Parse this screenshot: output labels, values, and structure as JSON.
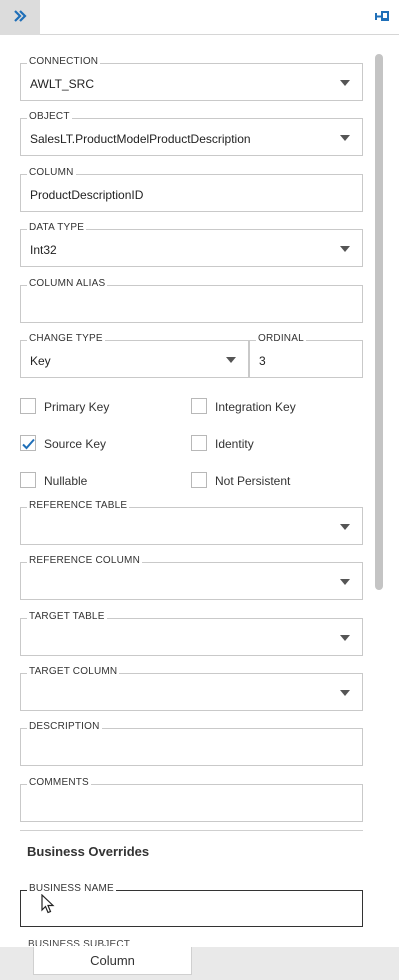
{
  "toolbar": {
    "collapse_icon": "double-chevron-right-icon",
    "pin_icon": "pin-icon",
    "accent_color": "#1f6fb8"
  },
  "fields": {
    "connection": {
      "label": "CONNECTION",
      "value": "AWLT_SRC"
    },
    "object": {
      "label": "OBJECT",
      "value": "SalesLT.ProductModelProductDescription"
    },
    "column": {
      "label": "COLUMN",
      "value": "ProductDescriptionID"
    },
    "data_type": {
      "label": "DATA TYPE",
      "value": "Int32"
    },
    "column_alias": {
      "label": "COLUMN ALIAS",
      "value": ""
    },
    "change_type": {
      "label": "CHANGE TYPE",
      "value": "Key"
    },
    "ordinal": {
      "label": "ORDINAL",
      "value": "3"
    },
    "reference_table": {
      "label": "REFERENCE TABLE",
      "value": ""
    },
    "reference_column": {
      "label": "REFERENCE COLUMN",
      "value": ""
    },
    "target_table": {
      "label": "TARGET TABLE",
      "value": ""
    },
    "target_column": {
      "label": "TARGET COLUMN",
      "value": ""
    },
    "description": {
      "label": "DESCRIPTION",
      "value": ""
    },
    "comments": {
      "label": "COMMENTS",
      "value": ""
    },
    "business_name": {
      "label": "BUSINESS NAME",
      "value": ""
    }
  },
  "checkboxes": {
    "primary_key": {
      "label": "Primary Key",
      "checked": false
    },
    "integration_key": {
      "label": "Integration Key",
      "checked": false
    },
    "source_key": {
      "label": "Source Key",
      "checked": true
    },
    "identity": {
      "label": "Identity",
      "checked": false
    },
    "nullable": {
      "label": "Nullable",
      "checked": false
    },
    "not_persistent": {
      "label": "Not Persistent",
      "checked": false
    }
  },
  "section": {
    "business_overrides": "Business Overrides",
    "next_field_partial": "BUSINESS SUBJECT"
  },
  "bottom_tab": {
    "label": "Column"
  }
}
